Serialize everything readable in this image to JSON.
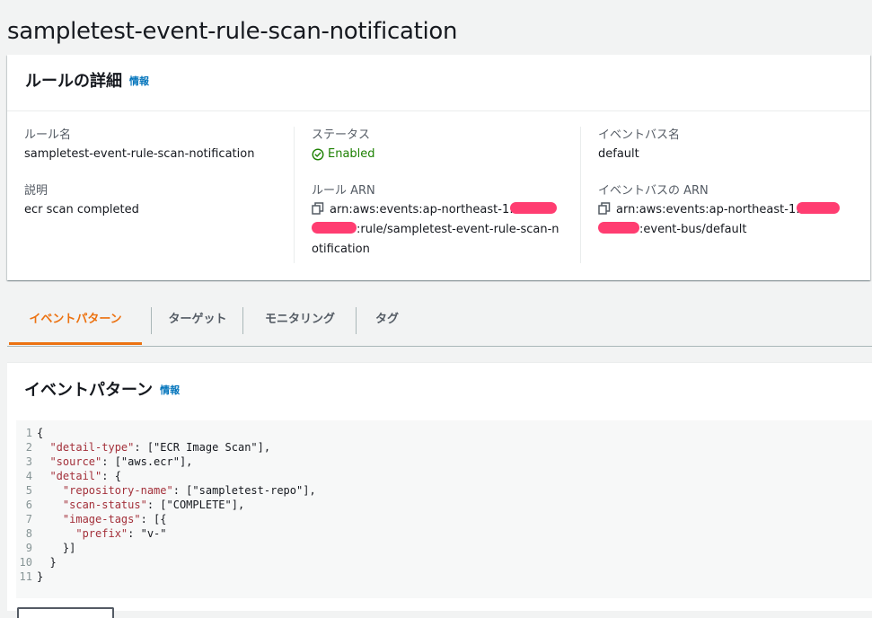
{
  "page_title": "sampletest-event-rule-scan-notification",
  "details": {
    "header": "ルールの詳細",
    "info_link": "情報",
    "rule_name_label": "ルール名",
    "rule_name_value": "sampletest-event-rule-scan-notification",
    "description_label": "説明",
    "description_value": "ecr scan completed",
    "status_label": "ステータス",
    "status_value": "Enabled",
    "rule_arn_label": "ルール ARN",
    "rule_arn_part1": "arn:aws:events:ap-northeast-1:",
    "rule_arn_part2": ":rule/sampletest-event-rule-scan-n",
    "rule_arn_part3": "otification",
    "event_bus_name_label": "イベントバス名",
    "event_bus_name_value": "default",
    "event_bus_arn_label": "イベントバスの ARN",
    "event_bus_arn_part1": "arn:aws:events:ap-northeast-1:",
    "event_bus_arn_part2": ":event-bus/default"
  },
  "tabs": [
    {
      "label": "イベントパターン",
      "active": true
    },
    {
      "label": "ターゲット",
      "active": false
    },
    {
      "label": "モニタリング",
      "active": false
    },
    {
      "label": "タグ",
      "active": false
    }
  ],
  "pattern": {
    "header": "イベントパターン",
    "info_link": "情報",
    "lines": [
      {
        "n": "1",
        "text": "{"
      },
      {
        "n": "2",
        "indent": "  ",
        "key": "\"detail-type\"",
        "rest": ": [\"ECR Image Scan\"],"
      },
      {
        "n": "3",
        "indent": "  ",
        "key": "\"source\"",
        "rest": ": [\"aws.ecr\"],"
      },
      {
        "n": "4",
        "indent": "  ",
        "key": "\"detail\"",
        "rest": ": {"
      },
      {
        "n": "5",
        "indent": "    ",
        "key": "\"repository-name\"",
        "rest": ": [\"sampletest-repo\"],"
      },
      {
        "n": "6",
        "indent": "    ",
        "key": "\"scan-status\"",
        "rest": ": [\"COMPLETE\"],"
      },
      {
        "n": "7",
        "indent": "    ",
        "key": "\"image-tags\"",
        "rest": ": [{"
      },
      {
        "n": "8",
        "indent": "      ",
        "key": "\"prefix\"",
        "rest": ": \"v-\""
      },
      {
        "n": "9",
        "text": "    }]"
      },
      {
        "n": "10",
        "text": "  }"
      },
      {
        "n": "11",
        "text": "}"
      }
    ]
  },
  "colors": {
    "accent": "#ec7211",
    "link": "#0073bb",
    "success": "#1d8102",
    "redaction": "#ff3d71"
  }
}
